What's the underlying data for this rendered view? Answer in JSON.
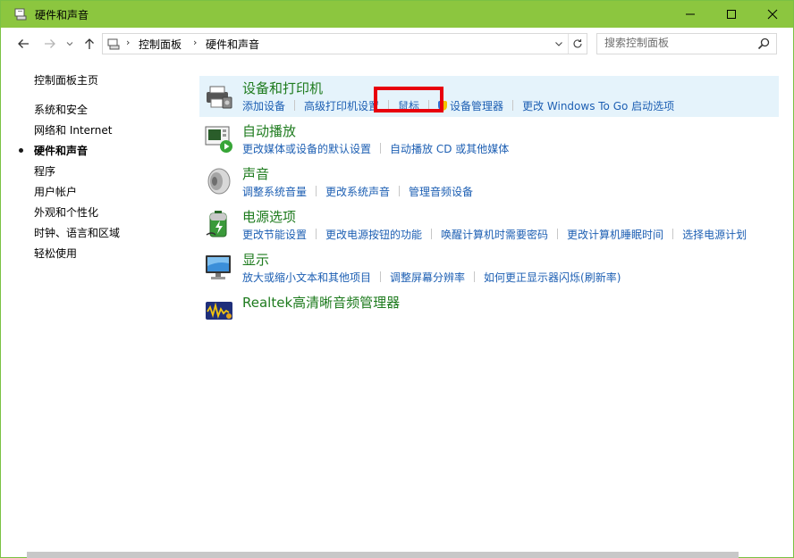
{
  "window": {
    "title": "硬件和声音",
    "accent_color": "#8cc63f",
    "controls": {
      "minimize": "minimize-icon",
      "maximize": "maximize-icon",
      "close": "close-icon"
    }
  },
  "address": {
    "breadcrumbs": [
      "控制面板",
      "硬件和声音"
    ]
  },
  "search": {
    "placeholder": "搜索控制面板"
  },
  "sidebar": {
    "items": [
      {
        "label": "控制面板主页",
        "current": false
      },
      {
        "label": "系统和安全",
        "current": false
      },
      {
        "label": "网络和 Internet",
        "current": false
      },
      {
        "label": "硬件和声音",
        "current": true
      },
      {
        "label": "程序",
        "current": false
      },
      {
        "label": "用户帐户",
        "current": false
      },
      {
        "label": "外观和个性化",
        "current": false
      },
      {
        "label": "时钟、语言和区域",
        "current": false
      },
      {
        "label": "轻松使用",
        "current": false
      }
    ]
  },
  "sections": [
    {
      "title": "设备和打印机",
      "icon": "printer-icon",
      "highlighted": true,
      "links": [
        "添加设备",
        "高级打印机设置",
        "鼠标",
        "设备管理器",
        "更改 Windows To Go 启动选项"
      ]
    },
    {
      "title": "自动播放",
      "icon": "autoplay-icon",
      "highlighted": false,
      "links": [
        "更改媒体或设备的默认设置",
        "自动播放 CD 或其他媒体"
      ]
    },
    {
      "title": "声音",
      "icon": "speaker-icon",
      "highlighted": false,
      "links": [
        "调整系统音量",
        "更改系统声音",
        "管理音频设备"
      ]
    },
    {
      "title": "电源选项",
      "icon": "battery-icon",
      "highlighted": false,
      "links": [
        "更改节能设置",
        "更改电源按钮的功能",
        "唤醒计算机时需要密码",
        "更改计算机睡眠时间",
        "选择电源计划"
      ]
    },
    {
      "title": "显示",
      "icon": "monitor-icon",
      "highlighted": false,
      "links": [
        "放大或缩小文本和其他项目",
        "调整屏幕分辨率",
        "如何更正显示器闪烁(刷新率)"
      ]
    },
    {
      "title": "Realtek高清晰音频管理器",
      "icon": "realtek-audio-icon",
      "highlighted": false,
      "links": []
    }
  ],
  "colors": {
    "link": "#1d5fb3",
    "section_title": "#1e7b1e",
    "highlight_bg": "#e5f3fb",
    "annotation": "#e8000d"
  }
}
